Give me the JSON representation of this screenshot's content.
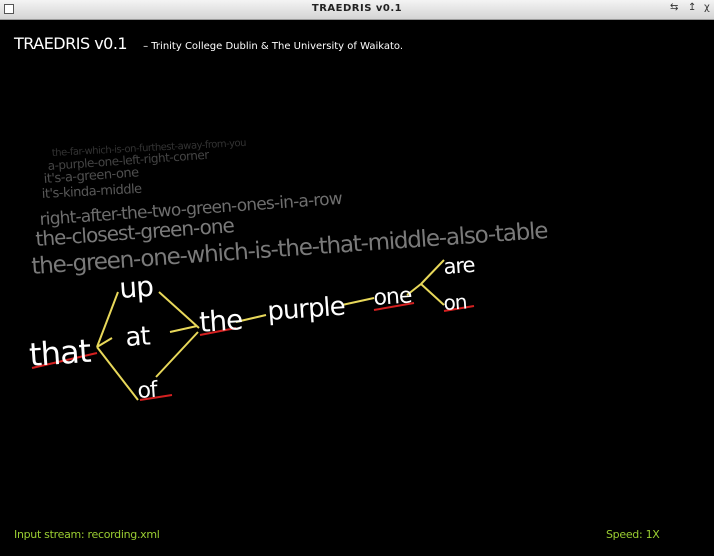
{
  "window": {
    "title": "TRAEDRIS v0.1"
  },
  "header": {
    "app_name": "TRAEDRIS v0.1",
    "subtitle": "–  Trinity College Dublin & The University of Waikato."
  },
  "history": [
    {
      "text": "the-green-one-which-is-the-that-middle-also-table",
      "color": "#7a7a7a"
    },
    {
      "text": "the-closest-green-one",
      "color": "#7a7a7a"
    },
    {
      "text": "right-after-the-two-green-ones-in-a-row",
      "color": "#6e6e6e"
    },
    {
      "text": "it's-kinda-middle",
      "color": "#585858"
    },
    {
      "text": "it's-a-green-one",
      "color": "#4e4e4e"
    },
    {
      "text": "a-purple-one-left-right-corner",
      "color": "#444444"
    },
    {
      "text": "the-far-which-is-on-furthest-away-from-you",
      "color": "#333333"
    }
  ],
  "lattice": {
    "words": {
      "that": "that",
      "up": "up",
      "at": "at",
      "of": "of",
      "the": "the",
      "purple": "purple",
      "one": "one",
      "are": "are",
      "on": "on"
    },
    "colors": {
      "word": "#ffffff",
      "edge": "#e8d85a",
      "underline": "#d42020"
    }
  },
  "status": {
    "input_stream": "Input stream: recording.xml",
    "speed": "Speed: 1X"
  },
  "colors": {
    "status_text": "#9acd32",
    "background": "#000000"
  }
}
